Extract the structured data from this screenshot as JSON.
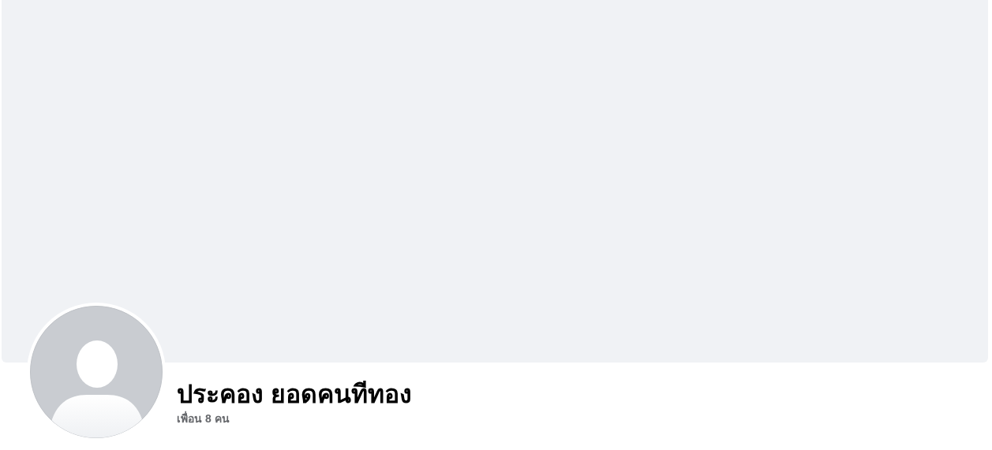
{
  "profile": {
    "name": "ประคอง ยอดคนทีทอง",
    "friends": "เพื่อน 8 คน"
  }
}
